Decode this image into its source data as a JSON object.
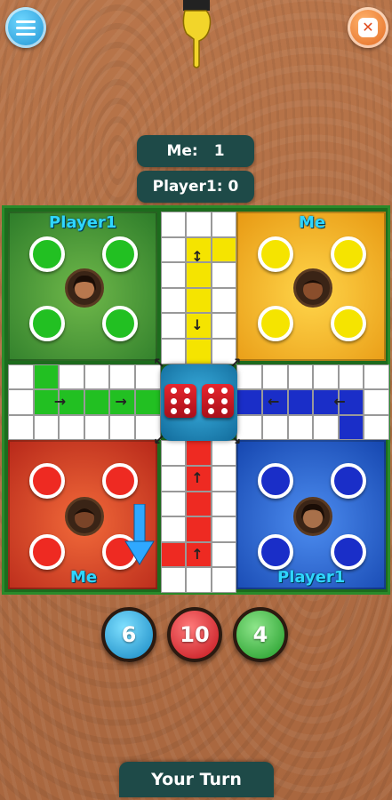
{
  "header": {
    "menu_icon": "hamburger-menu-icon",
    "close_icon": "close-icon",
    "pointer_icon": "pointing-hand-icon"
  },
  "scores": {
    "me_label": "Me:",
    "me_value": "1",
    "player1_label": "Player1:",
    "player1_value": "0"
  },
  "board": {
    "yards": {
      "green": {
        "label": "Player1",
        "color": "#2e7d2a",
        "token_color": "#22c022"
      },
      "yellow": {
        "label": "Me",
        "color": "#f0a81a",
        "token_color": "#f5e400"
      },
      "red": {
        "label": "Me",
        "color": "#c43020",
        "token_color": "#ee2a22"
      },
      "blue": {
        "label": "Player1",
        "color": "#1a52c0",
        "token_color": "#1a2ec8"
      }
    },
    "dice": [
      6,
      6
    ]
  },
  "rolls": [
    "6",
    "10",
    "4"
  ],
  "footer": {
    "status": "Your Turn"
  }
}
